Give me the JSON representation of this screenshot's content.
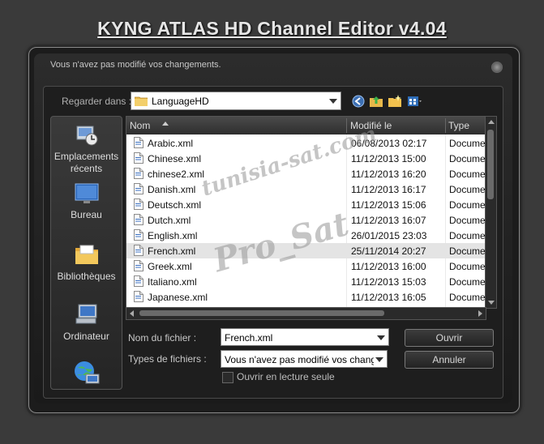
{
  "app_title": "KYNG ATLAS HD Channel Editor v4.04",
  "dialog": {
    "title": "Vous n'avez pas modifié vos changements."
  },
  "lookin": {
    "label": "Regarder dans :",
    "folder": "LanguageHD"
  },
  "toolbar": {
    "icons": [
      "back-icon",
      "up-folder-icon",
      "new-folder-icon",
      "view-menu-icon"
    ]
  },
  "places": [
    {
      "label": "Emplacements récents",
      "icon": "recent-places-icon"
    },
    {
      "label": "Bureau",
      "icon": "desktop-icon"
    },
    {
      "label": "Bibliothèques",
      "icon": "libraries-icon"
    },
    {
      "label": "Ordinateur",
      "icon": "computer-icon"
    },
    {
      "label": "",
      "icon": "network-icon"
    }
  ],
  "columns": {
    "name": "Nom",
    "modified": "Modifié le",
    "type": "Type"
  },
  "files": [
    {
      "name": "Arabic.xml",
      "date": "06/08/2013 02:17",
      "type": "Docume"
    },
    {
      "name": "Chinese.xml",
      "date": "11/12/2013 15:00",
      "type": "Docume"
    },
    {
      "name": "chinese2.xml",
      "date": "11/12/2013 16:20",
      "type": "Docume"
    },
    {
      "name": "Danish.xml",
      "date": "11/12/2013 16:17",
      "type": "Docume"
    },
    {
      "name": "Deutsch.xml",
      "date": "11/12/2013 15:06",
      "type": "Docume"
    },
    {
      "name": "Dutch.xml",
      "date": "11/12/2013 16:07",
      "type": "Docume"
    },
    {
      "name": "English.xml",
      "date": "26/01/2015 23:03",
      "type": "Docume"
    },
    {
      "name": "French.xml",
      "date": "25/11/2014 20:27",
      "type": "Docume",
      "selected": true
    },
    {
      "name": "Greek.xml",
      "date": "11/12/2013 16:00",
      "type": "Docume"
    },
    {
      "name": "Italiano.xml",
      "date": "11/12/2013 15:03",
      "type": "Docume"
    },
    {
      "name": "Japanese.xml",
      "date": "11/12/2013 16:05",
      "type": "Docume"
    }
  ],
  "filename": {
    "label": "Nom du fichier :",
    "value": "French.xml"
  },
  "filetype": {
    "label": "Types de fichiers :",
    "value": "Vous n'avez pas modifié vos changem"
  },
  "buttons": {
    "open": "Ouvrir",
    "cancel": "Annuler"
  },
  "readonly_label": "Ouvrir en lecture seule",
  "watermarks": {
    "site": "tunisia-sat.com",
    "author": "Pro_Sat"
  }
}
